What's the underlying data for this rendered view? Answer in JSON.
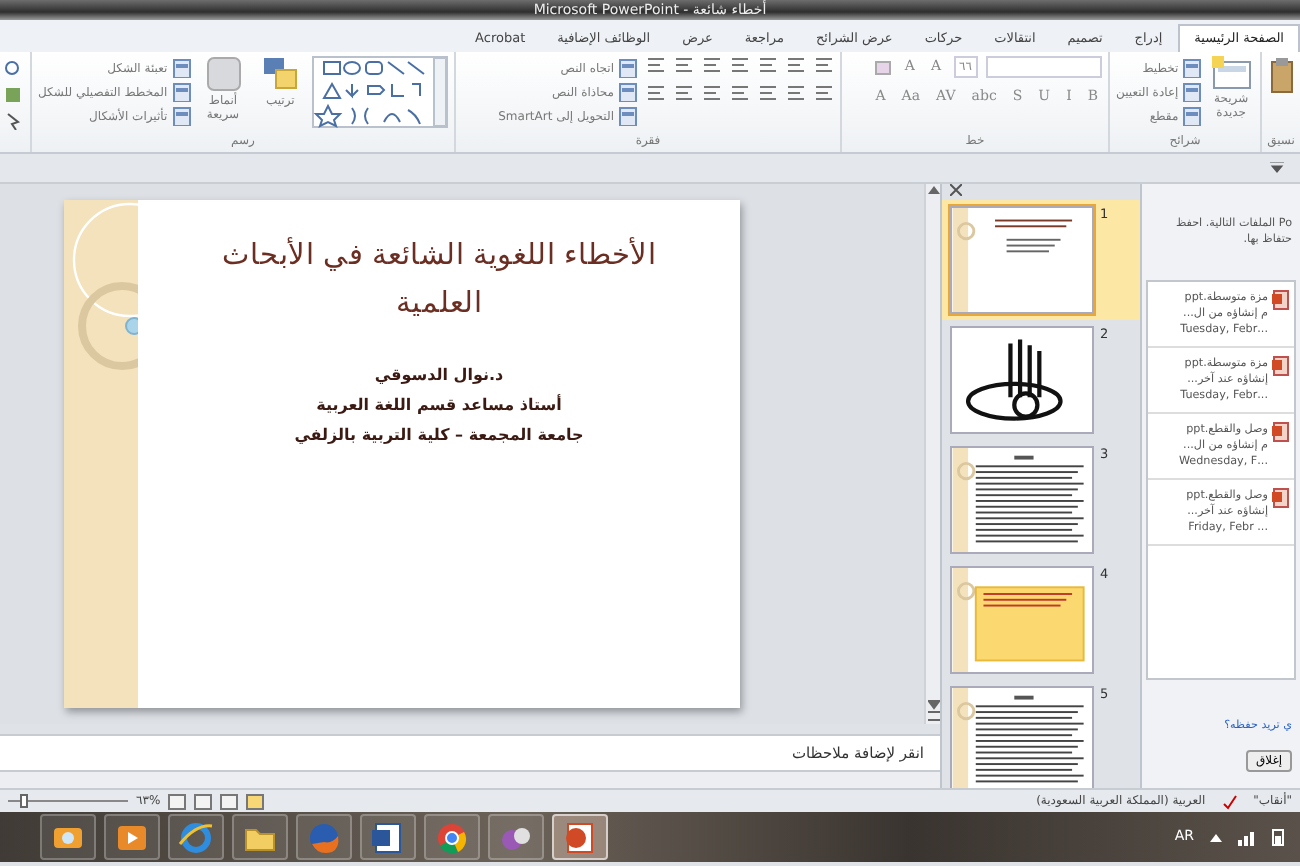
{
  "window": {
    "title": "Microsoft PowerPoint - أخطاء شائعة"
  },
  "tabs": [
    {
      "label": "الصفحة الرئيسية",
      "selected": true
    },
    {
      "label": "إدراج",
      "selected": false
    },
    {
      "label": "تصميم",
      "selected": false
    },
    {
      "label": "انتقالات",
      "selected": false
    },
    {
      "label": "حركات",
      "selected": false
    },
    {
      "label": "عرض الشرائح",
      "selected": false
    },
    {
      "label": "مراجعة",
      "selected": false
    },
    {
      "label": "عرض",
      "selected": false
    },
    {
      "label": "الوظائف الإضافية",
      "selected": false
    },
    {
      "label": "Acrobat",
      "selected": false
    }
  ],
  "ribbon": {
    "groups": [
      {
        "kind": "clipboard",
        "label": "نسيق"
      },
      {
        "kind": "slides",
        "label": "شرائح",
        "items": [
          {
            "kind": "big",
            "label": "شريحة جديدة"
          },
          {
            "kind": "small",
            "label": "تخطيط"
          },
          {
            "kind": "small",
            "label": "إعادة التعيين"
          },
          {
            "kind": "small",
            "label": "مقطع"
          }
        ]
      },
      {
        "kind": "font",
        "label": "خط",
        "font_size": "٦٦",
        "size_buttons": [
          "A",
          "A"
        ],
        "format_buttons": [
          "B",
          "I",
          "U",
          "S",
          "abc",
          "AV",
          "Aa",
          "A"
        ]
      },
      {
        "kind": "paragraph",
        "label": "فقرة",
        "items": [
          {
            "kind": "small",
            "label": "اتجاه النص"
          },
          {
            "kind": "small",
            "label": "محاذاة النص"
          },
          {
            "kind": "small",
            "label": "التحويل إلى SmartArt"
          }
        ]
      },
      {
        "kind": "drawing",
        "label": "رسم",
        "items": [
          {
            "kind": "big",
            "label": "ترتيب"
          },
          {
            "kind": "big",
            "label": "أنماط سريعة"
          },
          {
            "kind": "small",
            "label": "تعبئة الشكل"
          },
          {
            "kind": "small",
            "label": "المخطط التفصيلي للشكل"
          },
          {
            "kind": "small",
            "label": "تأثيرات الأشكال"
          }
        ]
      }
    ]
  },
  "slide": {
    "title": "الأخطاء اللغوية الشائعة في الأبحاث العلمية",
    "lines": [
      "د.نوال الدسوقي",
      "أستاذ مساعد قسم اللغة العربية",
      "جامعة المجمعة – كلية التربية بالزلفي"
    ]
  },
  "thumbnails": [
    {
      "number": "1",
      "kind": "title",
      "selected": true
    },
    {
      "number": "2",
      "kind": "calligraphy",
      "selected": false
    },
    {
      "number": "3",
      "kind": "text",
      "selected": false
    },
    {
      "number": "4",
      "kind": "note",
      "selected": false
    },
    {
      "number": "5",
      "kind": "text",
      "selected": false
    }
  ],
  "notes": {
    "placeholder": "انقر لإضافة ملاحظات"
  },
  "task_pane": {
    "intro": [
      "Po الملفات التالية. احفظ",
      "حتفاظ بها."
    ],
    "files": [
      {
        "name": "مزة متوسطة.ppt",
        "line_2": "م إنشاؤه من ال...",
        "line_3": "...Tuesday, Febr"
      },
      {
        "name": "مزة متوسطة.ppt",
        "line_2": "إنشاؤه عند آخر...",
        "line_3": "...Tuesday, Febr"
      },
      {
        "name": "وصل والقطع.ppt",
        "line_2": "م إنشاؤه من ال...",
        "line_3": "...Wednesday, F"
      },
      {
        "name": "وصل والقطع.ppt",
        "line_2": "إنشاؤه عند آخر...",
        "line_3": "... Friday, Febr"
      }
    ],
    "question": "ي تريد حفظه؟",
    "close_button": "إغلاق"
  },
  "status_bar": {
    "theme": "\"أنقاب\"",
    "language": "العربية (المملكة العربية السعودية)",
    "zoom": "%٦٣",
    "level": 0.1
  },
  "taskbar": {
    "apps": [
      {
        "kind": "camera",
        "selected": false
      },
      {
        "kind": "player",
        "selected": false
      },
      {
        "kind": "browser-e",
        "selected": false
      },
      {
        "kind": "folder",
        "selected": false
      },
      {
        "kind": "fox",
        "selected": false
      },
      {
        "kind": "word",
        "selected": false
      },
      {
        "kind": "chrome",
        "selected": false
      },
      {
        "kind": "chat",
        "selected": false
      },
      {
        "kind": "slides",
        "selected": true
      }
    ],
    "language": "AR"
  }
}
